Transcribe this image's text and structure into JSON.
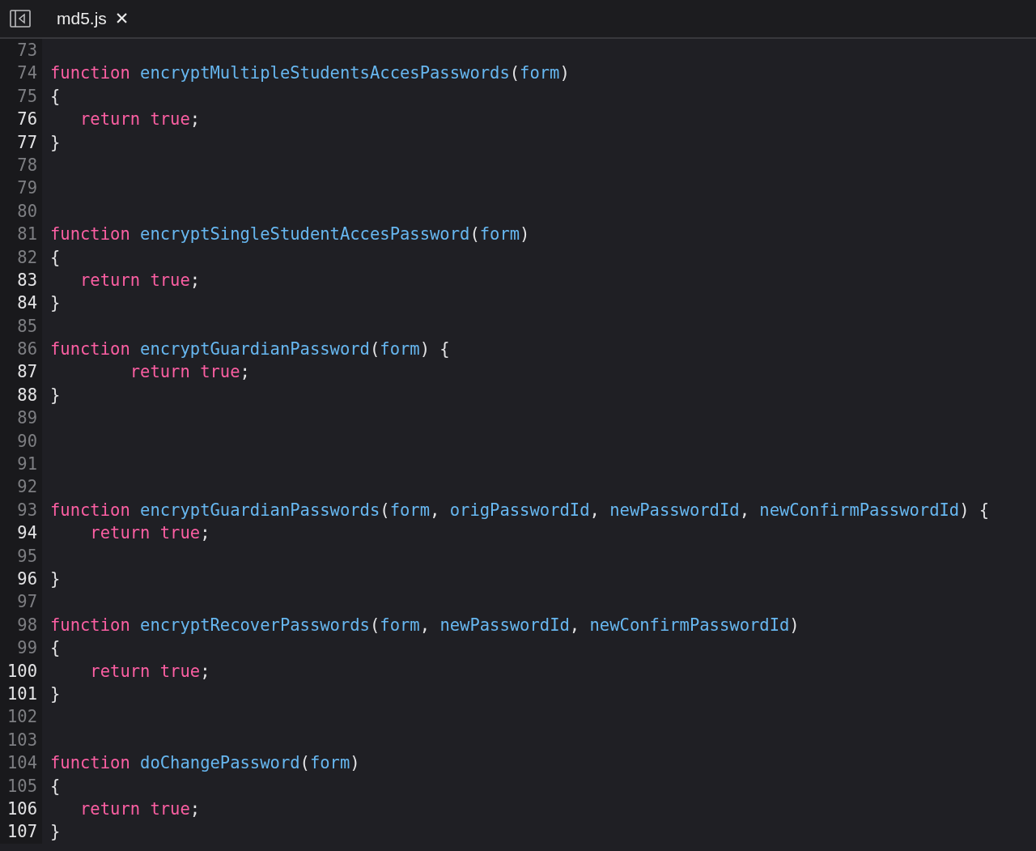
{
  "tab": {
    "title": "md5.js",
    "close": "✕"
  },
  "lines": [
    {
      "number": "73",
      "highlighted": false
    },
    {
      "number": "74",
      "highlighted": false,
      "tokens": [
        {
          "kind": "keyword",
          "text": "function"
        },
        {
          "kind": "identifier",
          "text": " encryptMultipleStudentsAccesPasswords"
        },
        {
          "kind": "plain",
          "text": "("
        },
        {
          "kind": "identifier",
          "text": "form"
        },
        {
          "kind": "plain",
          "text": ")"
        }
      ]
    },
    {
      "number": "75",
      "highlighted": false,
      "tokens": [
        {
          "kind": "plain",
          "text": "{"
        }
      ]
    },
    {
      "number": "76",
      "highlighted": true,
      "tokens": [
        {
          "kind": "keyword",
          "text": "   return true"
        },
        {
          "kind": "plain",
          "text": ";"
        }
      ]
    },
    {
      "number": "77",
      "highlighted": true,
      "tokens": [
        {
          "kind": "plain",
          "text": "}"
        }
      ]
    },
    {
      "number": "78",
      "highlighted": false
    },
    {
      "number": "79",
      "highlighted": false
    },
    {
      "number": "80",
      "highlighted": false
    },
    {
      "number": "81",
      "highlighted": false,
      "tokens": [
        {
          "kind": "keyword",
          "text": "function"
        },
        {
          "kind": "identifier",
          "text": " encryptSingleStudentAccesPassword"
        },
        {
          "kind": "plain",
          "text": "("
        },
        {
          "kind": "identifier",
          "text": "form"
        },
        {
          "kind": "plain",
          "text": ")"
        }
      ]
    },
    {
      "number": "82",
      "highlighted": false,
      "tokens": [
        {
          "kind": "plain",
          "text": "{"
        }
      ]
    },
    {
      "number": "83",
      "highlighted": true,
      "tokens": [
        {
          "kind": "keyword",
          "text": "   return true"
        },
        {
          "kind": "plain",
          "text": ";"
        }
      ]
    },
    {
      "number": "84",
      "highlighted": true,
      "tokens": [
        {
          "kind": "plain",
          "text": "}"
        }
      ]
    },
    {
      "number": "85",
      "highlighted": false
    },
    {
      "number": "86",
      "highlighted": false,
      "tokens": [
        {
          "kind": "keyword",
          "text": "function"
        },
        {
          "kind": "identifier",
          "text": " encryptGuardianPassword"
        },
        {
          "kind": "plain",
          "text": "("
        },
        {
          "kind": "identifier",
          "text": "form"
        },
        {
          "kind": "plain",
          "text": ") {"
        }
      ]
    },
    {
      "number": "87",
      "highlighted": true,
      "tokens": [
        {
          "kind": "keyword",
          "text": "        return true"
        },
        {
          "kind": "plain",
          "text": ";"
        }
      ]
    },
    {
      "number": "88",
      "highlighted": true,
      "tokens": [
        {
          "kind": "plain",
          "text": "}"
        }
      ]
    },
    {
      "number": "89",
      "highlighted": false
    },
    {
      "number": "90",
      "highlighted": false
    },
    {
      "number": "91",
      "highlighted": false
    },
    {
      "number": "92",
      "highlighted": false
    },
    {
      "number": "93",
      "highlighted": false,
      "tokens": [
        {
          "kind": "keyword",
          "text": "function"
        },
        {
          "kind": "identifier",
          "text": " encryptGuardianPasswords"
        },
        {
          "kind": "plain",
          "text": "("
        },
        {
          "kind": "identifier",
          "text": "form"
        },
        {
          "kind": "plain",
          "text": ", "
        },
        {
          "kind": "identifier",
          "text": "origPasswordId"
        },
        {
          "kind": "plain",
          "text": ", "
        },
        {
          "kind": "identifier",
          "text": "newPasswordId"
        },
        {
          "kind": "plain",
          "text": ", "
        },
        {
          "kind": "identifier",
          "text": "newConfirmPasswordId"
        },
        {
          "kind": "plain",
          "text": ") {"
        }
      ]
    },
    {
      "number": "94",
      "highlighted": true,
      "tokens": [
        {
          "kind": "keyword",
          "text": "    return true"
        },
        {
          "kind": "plain",
          "text": ";"
        }
      ]
    },
    {
      "number": "95",
      "highlighted": false
    },
    {
      "number": "96",
      "highlighted": true,
      "tokens": [
        {
          "kind": "plain",
          "text": "}"
        }
      ]
    },
    {
      "number": "97",
      "highlighted": false
    },
    {
      "number": "98",
      "highlighted": false,
      "tokens": [
        {
          "kind": "keyword",
          "text": "function"
        },
        {
          "kind": "identifier",
          "text": " encryptRecoverPasswords"
        },
        {
          "kind": "plain",
          "text": "("
        },
        {
          "kind": "identifier",
          "text": "form"
        },
        {
          "kind": "plain",
          "text": ", "
        },
        {
          "kind": "identifier",
          "text": "newPasswordId"
        },
        {
          "kind": "plain",
          "text": ", "
        },
        {
          "kind": "identifier",
          "text": "newConfirmPasswordId"
        },
        {
          "kind": "plain",
          "text": ")"
        }
      ]
    },
    {
      "number": "99",
      "highlighted": false,
      "tokens": [
        {
          "kind": "plain",
          "text": "{"
        }
      ]
    },
    {
      "number": "100",
      "highlighted": true,
      "tokens": [
        {
          "kind": "keyword",
          "text": "    return true"
        },
        {
          "kind": "plain",
          "text": ";"
        }
      ]
    },
    {
      "number": "101",
      "highlighted": true,
      "tokens": [
        {
          "kind": "plain",
          "text": "}"
        }
      ]
    },
    {
      "number": "102",
      "highlighted": false
    },
    {
      "number": "103",
      "highlighted": false
    },
    {
      "number": "104",
      "highlighted": false,
      "tokens": [
        {
          "kind": "keyword",
          "text": "function"
        },
        {
          "kind": "identifier",
          "text": " doChangePassword"
        },
        {
          "kind": "plain",
          "text": "("
        },
        {
          "kind": "identifier",
          "text": "form"
        },
        {
          "kind": "plain",
          "text": ")"
        }
      ]
    },
    {
      "number": "105",
      "highlighted": false,
      "tokens": [
        {
          "kind": "plain",
          "text": "{"
        }
      ]
    },
    {
      "number": "106",
      "highlighted": true,
      "tokens": [
        {
          "kind": "keyword",
          "text": "   return true"
        },
        {
          "kind": "plain",
          "text": ";"
        }
      ]
    },
    {
      "number": "107",
      "highlighted": true,
      "tokens": [
        {
          "kind": "plain",
          "text": "}"
        }
      ]
    }
  ]
}
